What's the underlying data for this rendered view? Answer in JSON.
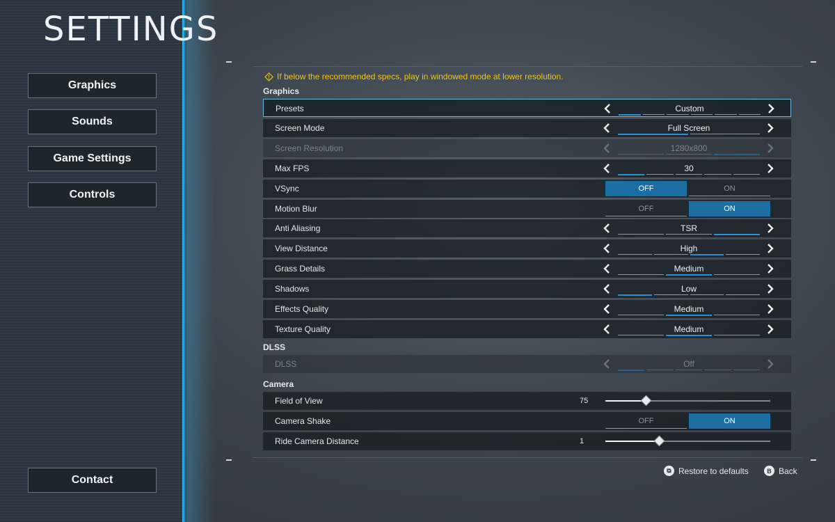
{
  "title": "SETTINGS",
  "nav": [
    {
      "label": "Graphics"
    },
    {
      "label": "Sounds"
    },
    {
      "label": "Game Settings"
    },
    {
      "label": "Controls"
    }
  ],
  "contact_label": "Contact",
  "warning": "If below the recommended specs, play in windowed mode at lower resolution.",
  "sections": {
    "graphics": "Graphics",
    "dlss": "DLSS",
    "camera": "Camera"
  },
  "rows": {
    "presets": {
      "label": "Presets",
      "value": "Custom"
    },
    "screen_mode": {
      "label": "Screen Mode",
      "value": "Full Screen"
    },
    "screen_resolution": {
      "label": "Screen Resolution",
      "value": "1280x800"
    },
    "max_fps": {
      "label": "Max FPS",
      "value": "30"
    },
    "vsync": {
      "label": "VSync",
      "off": "OFF",
      "on": "ON",
      "selected": "OFF"
    },
    "motion_blur": {
      "label": "Motion Blur",
      "off": "OFF",
      "on": "ON",
      "selected": "ON"
    },
    "anti_aliasing": {
      "label": "Anti Aliasing",
      "value": "TSR"
    },
    "view_distance": {
      "label": "View Distance",
      "value": "High"
    },
    "grass_details": {
      "label": "Grass Details",
      "value": "Medium"
    },
    "shadows": {
      "label": "Shadows",
      "value": "Low"
    },
    "effects_quality": {
      "label": "Effects Quality",
      "value": "Medium"
    },
    "texture_quality": {
      "label": "Texture Quality",
      "value": "Medium"
    },
    "dlss": {
      "label": "DLSS",
      "value": "Off"
    },
    "field_of_view": {
      "label": "Field of View",
      "value": "75",
      "level": 0.25
    },
    "camera_shake": {
      "label": "Camera Shake",
      "off": "OFF",
      "on": "ON",
      "selected": "ON"
    },
    "ride_camera_distance": {
      "label": "Ride Camera Distance",
      "value": "1",
      "level": 0.33
    }
  },
  "footer": {
    "restore": "Restore to defaults",
    "restore_glyph": "⧉",
    "back": "Back",
    "back_glyph": "B"
  },
  "colors": {
    "accent": "#1b6fa3",
    "warning": "#f0c419",
    "edge_glow": "#3ec8ff"
  }
}
